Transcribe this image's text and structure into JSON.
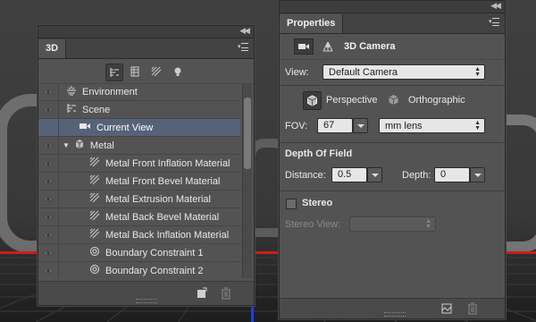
{
  "panel3d": {
    "tab_label": "3D",
    "layers": [
      {
        "label": "Environment",
        "icon": "environment-icon",
        "eye": true,
        "indent": 0,
        "selected": false
      },
      {
        "label": "Scene",
        "icon": "scene-icon",
        "eye": true,
        "indent": 0,
        "selected": false
      },
      {
        "label": "Current View",
        "icon": "camera-icon",
        "eye": false,
        "indent": 1,
        "selected": true
      },
      {
        "label": "Metal",
        "icon": "mesh-icon",
        "eye": true,
        "indent": 0,
        "selected": false,
        "expanded": true
      },
      {
        "label": "Metal Front Inflation Material",
        "icon": "material-icon",
        "eye": true,
        "indent": 2,
        "selected": false
      },
      {
        "label": "Metal Front Bevel Material",
        "icon": "material-icon",
        "eye": true,
        "indent": 2,
        "selected": false
      },
      {
        "label": "Metal Extrusion Material",
        "icon": "material-icon",
        "eye": true,
        "indent": 2,
        "selected": false
      },
      {
        "label": "Metal Back Bevel Material",
        "icon": "material-icon",
        "eye": true,
        "indent": 2,
        "selected": false
      },
      {
        "label": "Metal Back Inflation Material",
        "icon": "material-icon",
        "eye": true,
        "indent": 2,
        "selected": false
      },
      {
        "label": "Boundary Constraint 1",
        "icon": "constraint-icon",
        "eye": true,
        "indent": 2,
        "selected": false
      },
      {
        "label": "Boundary Constraint 2",
        "icon": "constraint-icon",
        "eye": true,
        "indent": 2,
        "selected": false
      }
    ]
  },
  "properties": {
    "tab_label": "Properties",
    "header_title": "3D Camera",
    "view_label": "View:",
    "view_value": "Default Camera",
    "perspective_label": "Perspective",
    "orthographic_label": "Orthographic",
    "projection_selected": "Perspective",
    "fov_label": "FOV:",
    "fov_value": "67",
    "fov_unit": "mm lens",
    "dof_title": "Depth Of Field",
    "distance_label": "Distance:",
    "distance_value": "0.5",
    "depth_label": "Depth:",
    "depth_value": "0",
    "stereo_label": "Stereo",
    "stereo_checked": false,
    "stereo_view_label": "Stereo View:"
  },
  "colors": {
    "panel_bg": "#535353",
    "selection": "#566277",
    "red_axis": "#c81e1e",
    "blue_axis": "#1d3fe0"
  }
}
